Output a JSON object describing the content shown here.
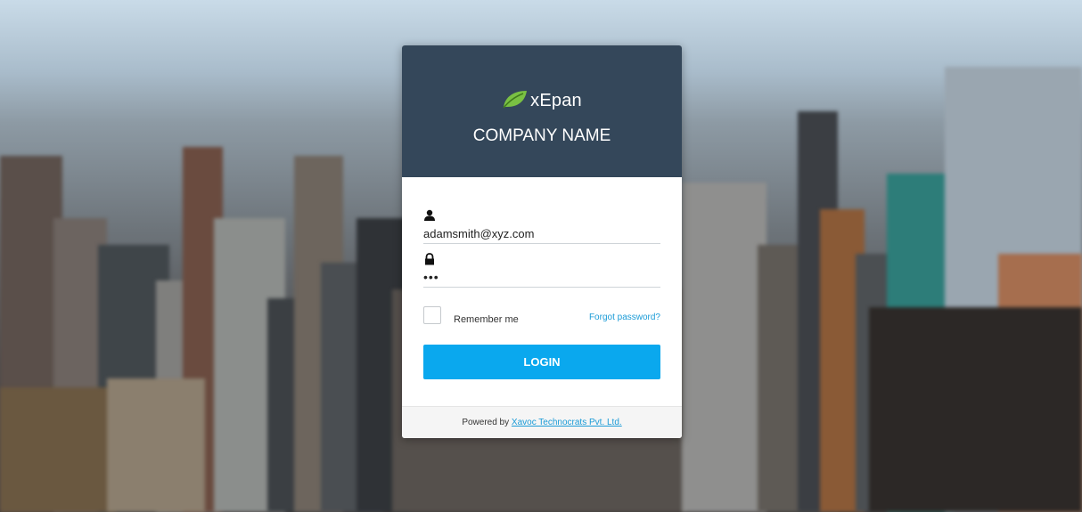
{
  "brand": {
    "name": "xEpan",
    "company": "COMPANY NAME",
    "logo_icon": "leaf-icon"
  },
  "form": {
    "username_icon": "user-icon",
    "username_value": "adamsmith@xyz.com",
    "password_icon": "lock-icon",
    "password_value": "•••",
    "remember_label": "Remember me",
    "remember_checked": false,
    "forgot_label": "Forgot password?",
    "login_label": "LOGIN"
  },
  "footer": {
    "prefix": "Powered by",
    "link_text": "Xavoc Technocrats Pvt. Ltd."
  },
  "colors": {
    "header_bg": "#34475a",
    "accent": "#0aa8ee",
    "leaf": "#7ac143",
    "link": "#1a9bd7"
  }
}
